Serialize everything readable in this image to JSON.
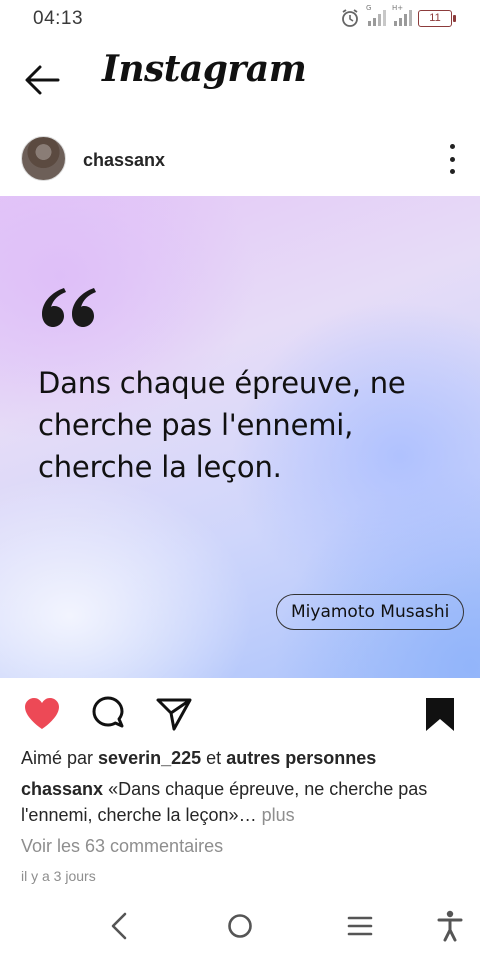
{
  "status_bar": {
    "time": "04:13",
    "network_1": "G",
    "network_2": "H+",
    "battery": "11"
  },
  "header": {
    "brand": "Instagram",
    "back_icon": "arrow-left-icon"
  },
  "post": {
    "username": "chassanx",
    "more_icon": "more-vertical-icon",
    "image": {
      "quote": "Dans chaque épreuve, ne cherche pas l'ennemi, cherche la leçon.",
      "author": "Miyamoto Musashi"
    },
    "actions": {
      "like_icon": "heart-icon",
      "liked": true,
      "like_color": "#ed4956",
      "comment_icon": "comment-icon",
      "share_icon": "send-icon",
      "save_icon": "bookmark-icon",
      "saved": true
    },
    "likes": {
      "prefix": "Aimé par",
      "user": "severin_225",
      "joiner": "et",
      "others": "autres personnes"
    },
    "caption": {
      "username": "chassanx",
      "text": "«Dans chaque épreuve, ne cherche pas l'ennemi, cherche la leçon»…",
      "more": "plus"
    },
    "comments_link": "Voir les 63 commentaires",
    "timestamp": "il y a 3 jours"
  },
  "nav_bar": {
    "back_icon": "nav-back-icon",
    "home_icon": "nav-home-icon",
    "recents_icon": "nav-recents-icon",
    "accessibility_icon": "accessibility-icon"
  }
}
